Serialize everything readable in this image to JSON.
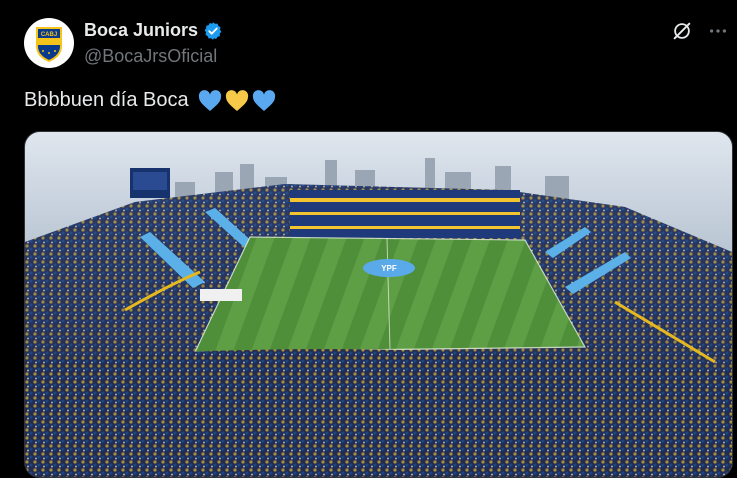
{
  "account": {
    "display_name": "Boca Juniors",
    "handle": "@BocaJrsOficial",
    "avatar_text": "CABJ",
    "verified": true
  },
  "tweet": {
    "text": "Bbbbuen día Boca",
    "emojis": [
      "blue-heart",
      "yellow-heart",
      "blue-heart"
    ]
  },
  "media": {
    "description_icon": "stadium-photo",
    "field_logo_text": "YPF"
  },
  "icons": {
    "grok": "grok-icon",
    "more": "more-options-icon"
  },
  "colors": {
    "boca_blue": "#0a3a8c",
    "boca_yellow": "#f5c31a",
    "verified_blue": "#1d9bf0",
    "heart_blue": "#5aa9f0",
    "heart_yellow": "#f7c948"
  }
}
